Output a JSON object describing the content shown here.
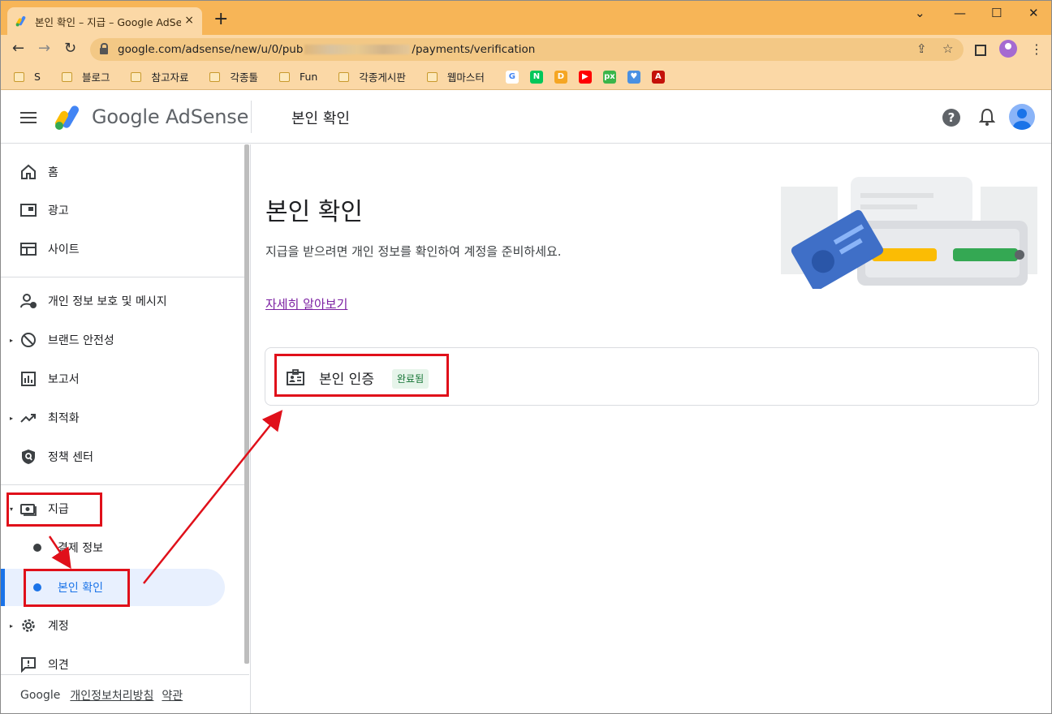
{
  "browser": {
    "tab_title": "본인 확인 – 지급 – Google AdSense",
    "tab_close": "×",
    "new_tab": "+",
    "url_prefix": "google.com/adsense/new/u/0/pub",
    "url_suffix": "/payments/verification",
    "bookmarks": [
      {
        "label": "S",
        "kind": "folder"
      },
      {
        "label": "블로그",
        "kind": "folder"
      },
      {
        "label": "참고자료",
        "kind": "folder"
      },
      {
        "label": "각종툴",
        "kind": "folder"
      },
      {
        "label": "Fun",
        "kind": "folder"
      },
      {
        "label": "각종게시판",
        "kind": "folder"
      },
      {
        "label": "웹마스터",
        "kind": "folder"
      }
    ],
    "bookmark_icons": [
      {
        "name": "google-icon",
        "glyph": "G",
        "color": "#ffffff",
        "text": "#4285f4"
      },
      {
        "name": "naver-icon",
        "glyph": "N",
        "color": "#03c75a",
        "text": "#ffffff"
      },
      {
        "name": "daum-icon",
        "glyph": "D",
        "color": "#f5a623",
        "text": "#ffffff"
      },
      {
        "name": "youtube-icon",
        "glyph": "▶",
        "color": "#ff0000",
        "text": "#ffffff"
      },
      {
        "name": "pixlr-icon",
        "glyph": "px",
        "color": "#3bb54a",
        "text": "#ffffff"
      },
      {
        "name": "heart-icon",
        "glyph": "♥",
        "color": "#4a90e2",
        "text": "#ffffff"
      },
      {
        "name": "pdf-icon",
        "glyph": "A",
        "color": "#c4120a",
        "text": "#ffffff"
      }
    ]
  },
  "header": {
    "logo_text": "Google AdSense",
    "page_title": "본인 확인"
  },
  "sidebar": {
    "items": [
      {
        "label": "홈",
        "icon": "home-icon"
      },
      {
        "label": "광고",
        "icon": "ads-icon"
      },
      {
        "label": "사이트",
        "icon": "sites-icon"
      },
      {
        "label": "개인 정보 보호 및 메시지",
        "icon": "privacy-icon"
      },
      {
        "label": "브랜드 안전성",
        "icon": "block-icon"
      },
      {
        "label": "보고서",
        "icon": "reports-icon"
      },
      {
        "label": "최적화",
        "icon": "trending-icon"
      },
      {
        "label": "정책 센터",
        "icon": "shield-icon"
      },
      {
        "label": "지급",
        "icon": "payments-icon"
      },
      {
        "label": "계정",
        "icon": "gear-icon"
      },
      {
        "label": "의견",
        "icon": "feedback-icon"
      }
    ],
    "sub_items": [
      {
        "label": "결제 정보"
      },
      {
        "label": "본인 확인"
      }
    ],
    "footer": {
      "google": "Google",
      "privacy": "개인정보처리방침",
      "terms": "약관"
    }
  },
  "main": {
    "title": "본인 확인",
    "description": "지급을 받으려면 개인 정보를 확인하여 계정을 준비하세요.",
    "learn_more": "자세히 알아보기",
    "card": {
      "label": "본인 인증",
      "status": "완료됨"
    }
  },
  "colors": {
    "browser_chrome": "#f7b557",
    "accent": "#1a73e8",
    "annotation": "#e0101a",
    "badge_bg": "#e6f4ea",
    "badge_text": "#137333"
  }
}
